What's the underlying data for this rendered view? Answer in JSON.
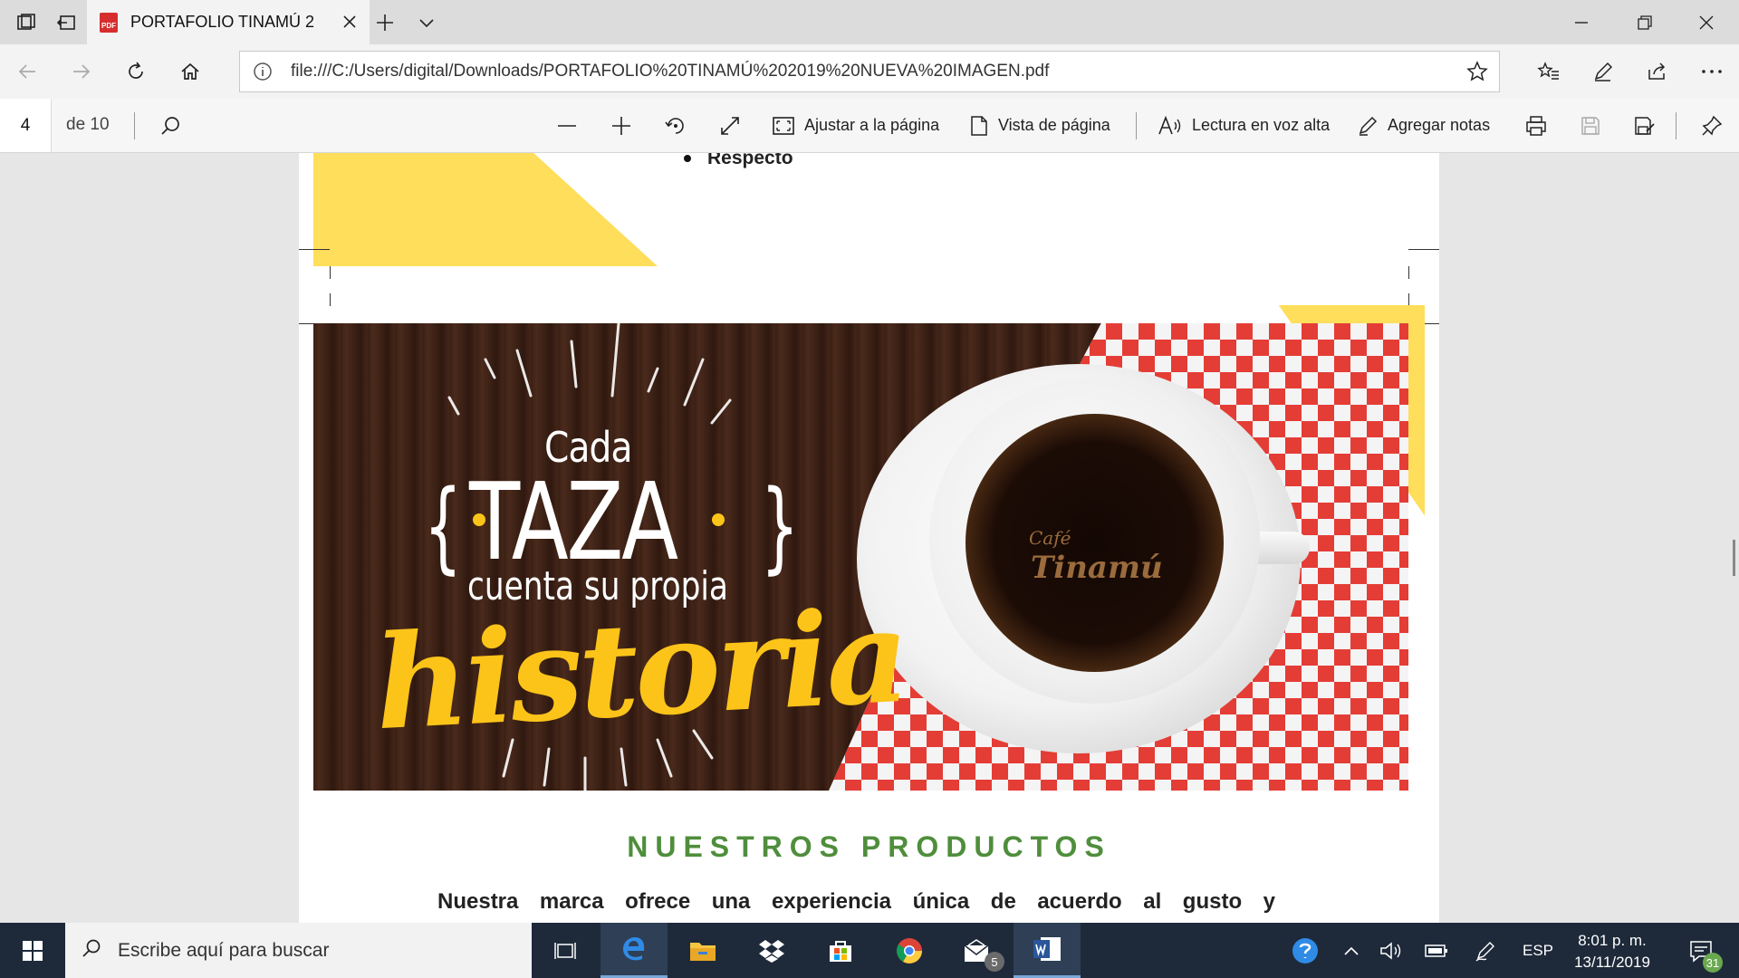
{
  "browser": {
    "tab_title": "PORTAFOLIO TINAMÚ 2",
    "tab_icon_text": "PDF",
    "url": "file:///C:/Users/digital/Downloads/PORTAFOLIO%20TINAMÚ%202019%20NUEVA%20IMAGEN.pdf"
  },
  "pdf_toolbar": {
    "page_number": "4",
    "page_total": "de 10",
    "fit_page_label": "Ajustar a la página",
    "page_view_label": "Vista de página",
    "read_aloud_label": "Lectura en voz alta",
    "add_notes_label": "Agregar notas"
  },
  "document": {
    "prev_bullet": "Respecto",
    "hero": {
      "line1": "Cada",
      "line2": "TAZA",
      "line3": "cuenta su propia",
      "line4": "historia",
      "logo_small": "Café",
      "logo_big": "Tinamú"
    },
    "section_title": "NUESTROS PRODUCTOS",
    "body_text": "Nuestra marca ofrece una experiencia única de acuerdo al gusto y"
  },
  "taskbar": {
    "search_placeholder": "Escribe aquí para buscar",
    "language": "ESP",
    "time": "8:01 p. m.",
    "date": "13/11/2019",
    "mail_badge": "5",
    "notification_count": "31"
  },
  "colors": {
    "accent_yellow": "#fede5a",
    "section_green": "#4f8e3c",
    "historia_yellow": "#fcc419",
    "taskbar_bg": "#1e2a3a"
  }
}
